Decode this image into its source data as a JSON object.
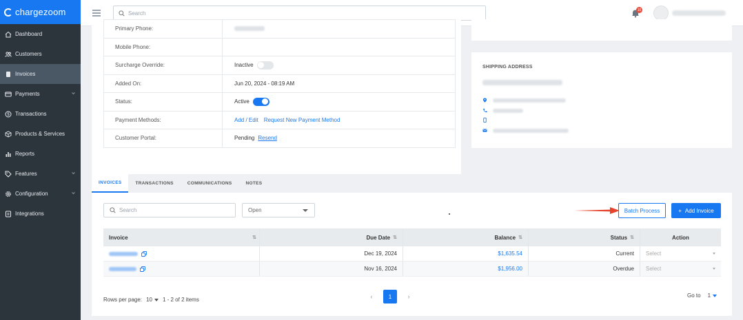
{
  "brand": {
    "name": "chargezoom",
    "color": "#1778f2"
  },
  "sidebar": {
    "items": [
      {
        "label": "Dashboard",
        "icon": "home-icon",
        "active": false,
        "has_submenu": false
      },
      {
        "label": "Customers",
        "icon": "users-icon",
        "active": false,
        "has_submenu": false
      },
      {
        "label": "Invoices",
        "icon": "invoice-icon",
        "active": true,
        "has_submenu": false
      },
      {
        "label": "Payments",
        "icon": "card-icon",
        "active": false,
        "has_submenu": true
      },
      {
        "label": "Transactions",
        "icon": "dollar-icon",
        "active": false,
        "has_submenu": false
      },
      {
        "label": "Products & Services",
        "icon": "box-icon",
        "active": false,
        "has_submenu": false
      },
      {
        "label": "Reports",
        "icon": "chart-icon",
        "active": false,
        "has_submenu": false
      },
      {
        "label": "Features",
        "icon": "tag-icon",
        "active": false,
        "has_submenu": true
      },
      {
        "label": "Configuration",
        "icon": "gear-icon",
        "active": false,
        "has_submenu": true
      },
      {
        "label": "Integrations",
        "icon": "plug-icon",
        "active": false,
        "has_submenu": false
      }
    ]
  },
  "header": {
    "search_placeholder": "Search",
    "notification_count": "10"
  },
  "customer_info": {
    "rows": [
      {
        "label": "Primary Phone:"
      },
      {
        "label": "Mobile Phone:"
      },
      {
        "label": "Surcharge Override:",
        "value": "Inactive"
      },
      {
        "label": "Added On:",
        "value": "Jun 20, 2024 - 08:19 AM"
      },
      {
        "label": "Status:",
        "value": "Active"
      },
      {
        "label": "Payment Methods:",
        "link1": "Add / Edit",
        "link2": "Request New Payment Method"
      },
      {
        "label": "Customer Portal:",
        "value": "Pending",
        "link": "Resend"
      }
    ]
  },
  "shipping": {
    "title": "SHIPPING ADDRESS"
  },
  "tabs": [
    {
      "label": "INVOICES",
      "active": true
    },
    {
      "label": "TRANSACTIONS",
      "active": false
    },
    {
      "label": "COMMUNICATIONS",
      "active": false
    },
    {
      "label": "NOTES",
      "active": false
    }
  ],
  "toolbar": {
    "search_placeholder": "Search",
    "status_value": "Open",
    "batch_label": "Batch Process",
    "add_label": "Add Invoice",
    "add_icon": "+"
  },
  "grid": {
    "columns": [
      "Invoice",
      "Due Date",
      "Balance",
      "Status",
      "Action"
    ],
    "sort_icon": "⇅",
    "rows": [
      {
        "due_date": "Dec 19, 2024",
        "balance": "$1,635.54",
        "status": "Current",
        "action": "Select"
      },
      {
        "due_date": "Nov 16, 2024",
        "balance": "$1,956.00",
        "status": "Overdue",
        "action": "Select"
      }
    ]
  },
  "pagination": {
    "rows_per_page_label": "Rows per page:",
    "rows_per_page": "10",
    "range": "1 - 2 of 2 items",
    "current_page": "1",
    "prev": "‹",
    "next": "›",
    "goto_label": "Go to",
    "goto_value": "1"
  }
}
